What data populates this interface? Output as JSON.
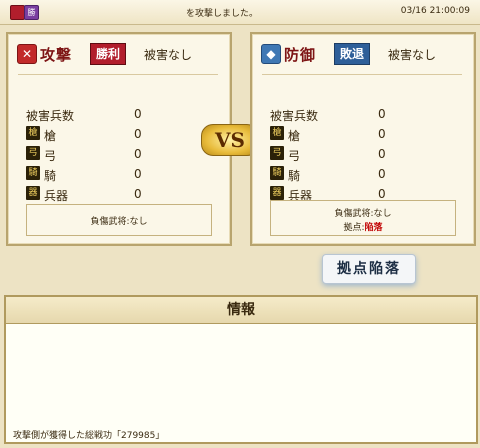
{
  "header": {
    "badge_label": "勝",
    "message": "を攻撃しました。",
    "timestamp": "03/16 21:00:09"
  },
  "attack": {
    "title": "攻撃",
    "result": "勝利",
    "damage": "被害なし",
    "stats_label": "被害兵数",
    "stats_total": "0",
    "units": [
      {
        "label": "槍",
        "value": "0"
      },
      {
        "label": "弓",
        "value": "0"
      },
      {
        "label": "騎",
        "value": "0"
      },
      {
        "label": "兵器",
        "value": "0"
      }
    ],
    "casualty_text": "負傷武将:なし"
  },
  "defense": {
    "title": "防御",
    "result": "敗退",
    "damage": "被害なし",
    "stats_label": "被害兵数",
    "stats_total": "0",
    "units": [
      {
        "label": "槍",
        "value": "0"
      },
      {
        "label": "弓",
        "value": "0"
      },
      {
        "label": "騎",
        "value": "0"
      },
      {
        "label": "兵器",
        "value": "0"
      }
    ],
    "casualty_text": "負傷武将:なし",
    "base_label": "拠点:",
    "base_status": "陥落"
  },
  "vs_label": "VS",
  "stamp_label": "拠点陥落",
  "info": {
    "title": "情報",
    "text": "攻撃側が獲得した総戦功「279985」"
  }
}
